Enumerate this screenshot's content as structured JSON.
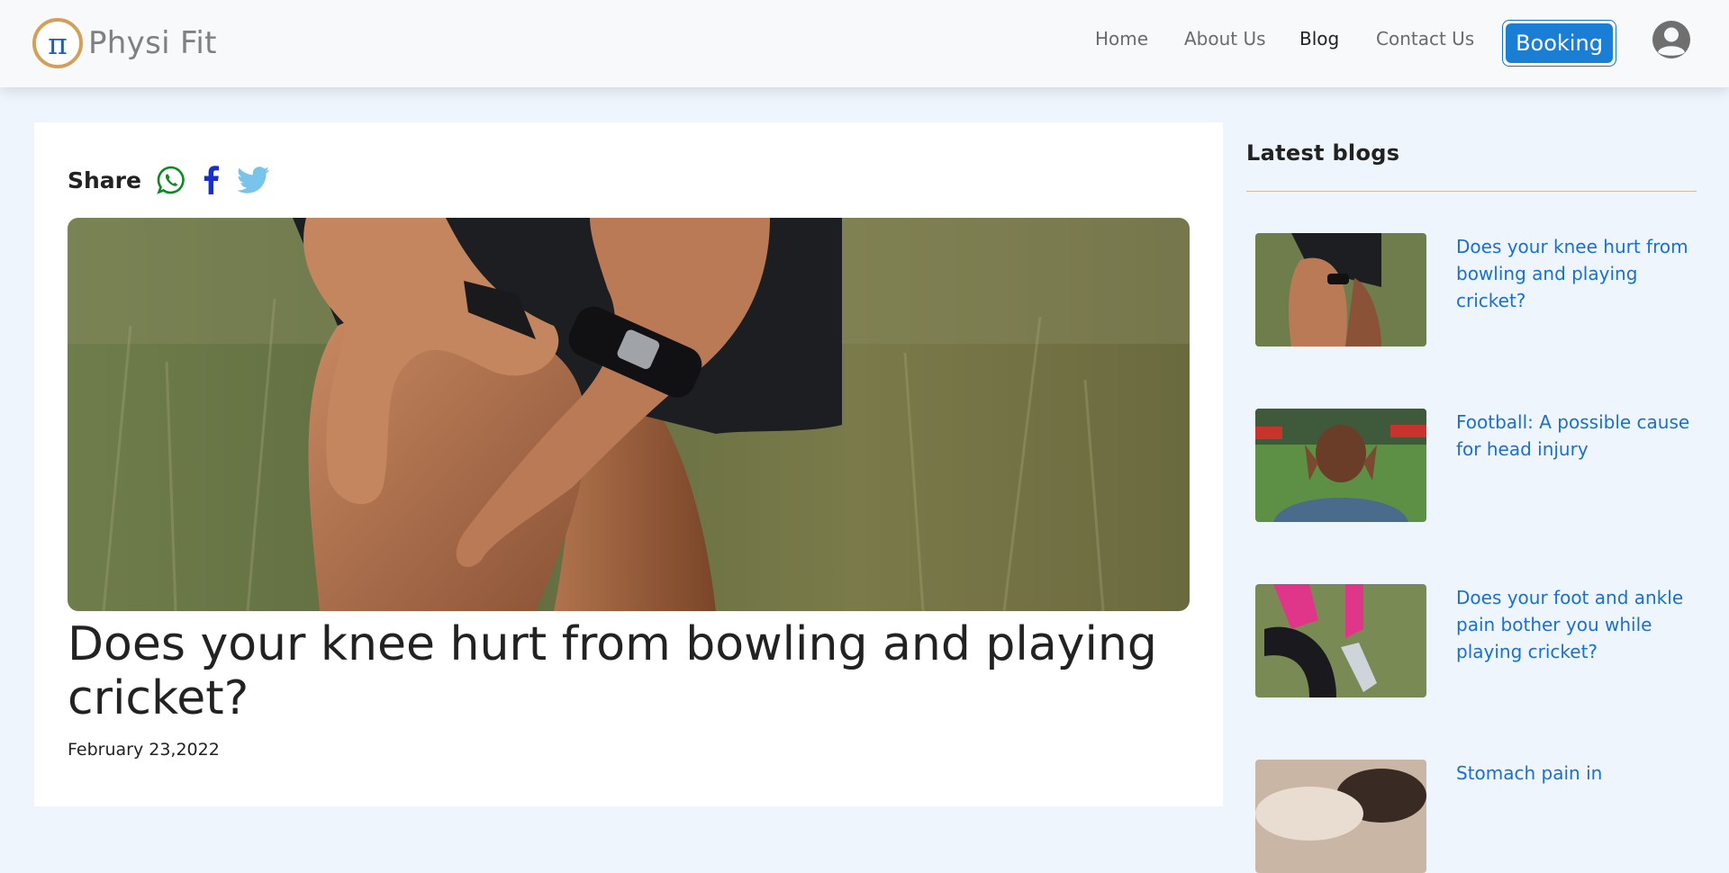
{
  "brand": {
    "name": "Physi Fit",
    "logo_glyph": "π",
    "accent": "#d3a05a",
    "primary": "#1a7fd4"
  },
  "nav": {
    "links": [
      {
        "label": "Home"
      },
      {
        "label": "About Us"
      },
      {
        "label": "Blog",
        "active": true
      },
      {
        "label": "Contact Us"
      }
    ],
    "booking_label": "Booking",
    "profile_icon": "user-circle-icon"
  },
  "article": {
    "share_label": "Share",
    "share_icons": [
      "whatsapp-icon",
      "facebook-icon",
      "twitter-icon"
    ],
    "title": "Does your knee hurt from bowling and playing cricket?",
    "date": "February 23,2022"
  },
  "sidebar": {
    "title": "Latest blogs",
    "items": [
      {
        "title": "Does your knee hurt from bowling and playing cricket?"
      },
      {
        "title": "Football: A possible cause for head injury"
      },
      {
        "title": "Does your foot and ankle pain bother you while playing cricket?"
      },
      {
        "title": "Stomach pain in"
      }
    ]
  }
}
